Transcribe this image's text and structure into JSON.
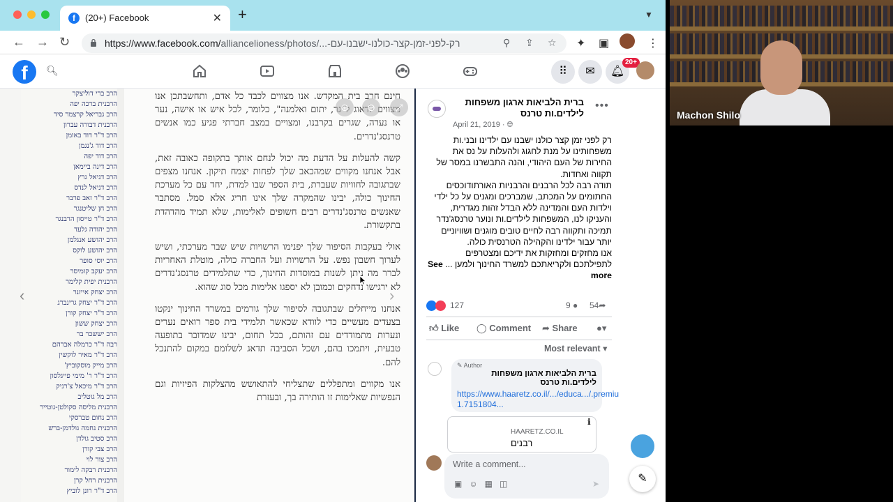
{
  "browser": {
    "tab_title": "(20+) Facebook",
    "url_host": "https://www.facebook.com/",
    "url_path": "alliancelioness/photos/...-רק-לפני-זמן-קצר-כולנו-ישבנו-עם"
  },
  "facebook": {
    "notif_count": "20+"
  },
  "photo": {
    "names": [
      "הרב ברי דוליצקר",
      "הרבנית ברכה יפה",
      "הרב גבריאל קרצמר סיד",
      "הרבנית דבורה עברון",
      "הרב ד\"ר דוד באומן",
      "הרב דוד ג'נגמן",
      "הרב דוד יפה",
      "הרב דינה ביימאן",
      "הרב דניאל גרץ",
      "הרב דניאל לנדס",
      "הרב ד\"ר זאב פרבר",
      "הרב חן שליטנגר",
      "הרב ד\"ר טייסון הרבנגר",
      "הרב יהודה גלעד",
      "הרב יהושע אנגלמן",
      "הרב יהושע לוקס",
      "הרב יוסי סופר",
      "הרב יעקב קומיסר",
      "הרבנית יפית קלימר",
      "הרב יצחק אייזנר",
      "הרב ד\"ר יצחק גרינברג",
      "הרב ד\"ר יצחק קורן",
      "הרב יצחק ששון",
      "הרב יששכר בר",
      "רבה ד\"ר כרמלה אברהם",
      "הרב ד\"ר מאיר לוקשין",
      "הרב מייק מוסקוביץ'",
      "הרב ד\"ר ר' מימי פייגלסון",
      "הרב ד\"ר מיכאל צ'רניק",
      "הרב מל גוטליב",
      "הרבנית מליסה סקולטן-גוטייר",
      "הרב נחום טברסקי",
      "הרבנית נחמה גולדמן-ברש",
      "הרב סטיב גולדן",
      "הרב צבי קורן",
      "הרב צור לוי",
      "הרבנית רבקה לימור",
      "הרבנית רחל קרן",
      "הרב ד\"ר רונן לוביץ"
    ],
    "paragraphs": [
      "חינם חרב בית המקדש. אנו מצווים לכבד כל אדם, ותחשבתכן אנו מצווים לדאוג ל\"גר, יתום ואלמנה\", כלומר, לכל איש או אישה, נער או נערה, שגרים בקרבנו, ומצויים במצב חברתי פגיע כמו אנשים טרנסג'נדרים.",
      "קשה להעלות על הדעת מה יכול לנחם אותך בתקופה כאובה זאת, אבל אנחנו מקווים שמהכאב שלך לפחות יצמח תיקון. אנחנו מצפים שבתגובה לחוויות שעברת, בית הספר שבו למדת, יחד עם כל מערכת החינוך כולה, יבינו שהמקרה שלך אינו חריג אלא סמל. מסתבר שאנשים טרנסג'נדרים רבים חשופים לאלימות, שלא תמיד מהדהדת בתקשורת.",
      "אולי בעקבות הסיפור שלך יפנימו הרשויות שיש שבר מערכתי, ושיש לערוך חשבון נפש. על הרשויות ועל החברה כולה, מוטלת האחריות לברר מה ניתן לשנות במוסדות החינוך, כדי שתלמידים טרנסג'נדרים לא ירגישו נדחקים וכמובן לא יספגו אלימות מכל סוג שהוא.",
      "אנחנו מייחלים שבתגובה לסיפור שלך גורמים במשרד החינוך ינקטו בצעדים מעשיים כדי לוודא שכאשר תלמידי בית ספר רואים נערים ונערות מתמודדים עם זהותם, בכל תחום, יבינו שמדובר בתופעה טבעית, ויתמכו בהם, ושכל הסביבה תדאג לשלומם במקום להתנכל להם.",
      "אנו מקווים ומתפללים שתצליחי להתאושש מהצלקות הפיזיות וגם הנפשיות שאלימות זו הותירה בך, ובעזרת"
    ]
  },
  "post": {
    "page_name": "ברית הלביאות ארגון משפחות לילדים.ות טרנס",
    "date": "April 21, 2019 · ",
    "body": "רק לפני זמן קצר כולנו ישבנו עם ילדינו ובני.ות משפחותינו על מנת לחגוג ולהעלות על נס את החירות של העם היהודי, והנה התבשרנו במסר של תקווה ואחדות.\nתודה רבה לכל הרבנים והרבניות האורתודוכסים החתומים על המכתב, שמברכים ומגנים על כל ילדי וילדות העם והמדינה ללא הבדל זהות מגדרית, והעניקו לנו, המשפחות לילדים.ות ונוער טרנסג'נדר תמיכה ותקווה רבה לחיים טובים מוגנים ושוויוניים יותר עבור ילדינו והקהילה הטרנסית כולה.\nאנו מחזקים ומחזקות את ידיכם ומצטרפים לתפילתכם ולקריאתכם למשרד החינוך ולמען ...",
    "see_more": "See more",
    "reaction_count": "127",
    "comment_count": "9",
    "share_count": "54",
    "like_label": "Like",
    "comment_label": "Comment",
    "share_label": "Share",
    "sort_label": "Most relevant",
    "comment_author_tag": "Author",
    "comment_author": "ברית הלביאות ארגון משפחות לילדים.ות טרנס",
    "comment_link": "https://www.haaretz.co.il/.../educa.../.premium-1.7151804...",
    "card_domain": "HAARETZ.CO.IL",
    "card_title": "רבנים",
    "write_placeholder": "Write a comment..."
  },
  "webcam": {
    "label": "Machon Shilo"
  }
}
